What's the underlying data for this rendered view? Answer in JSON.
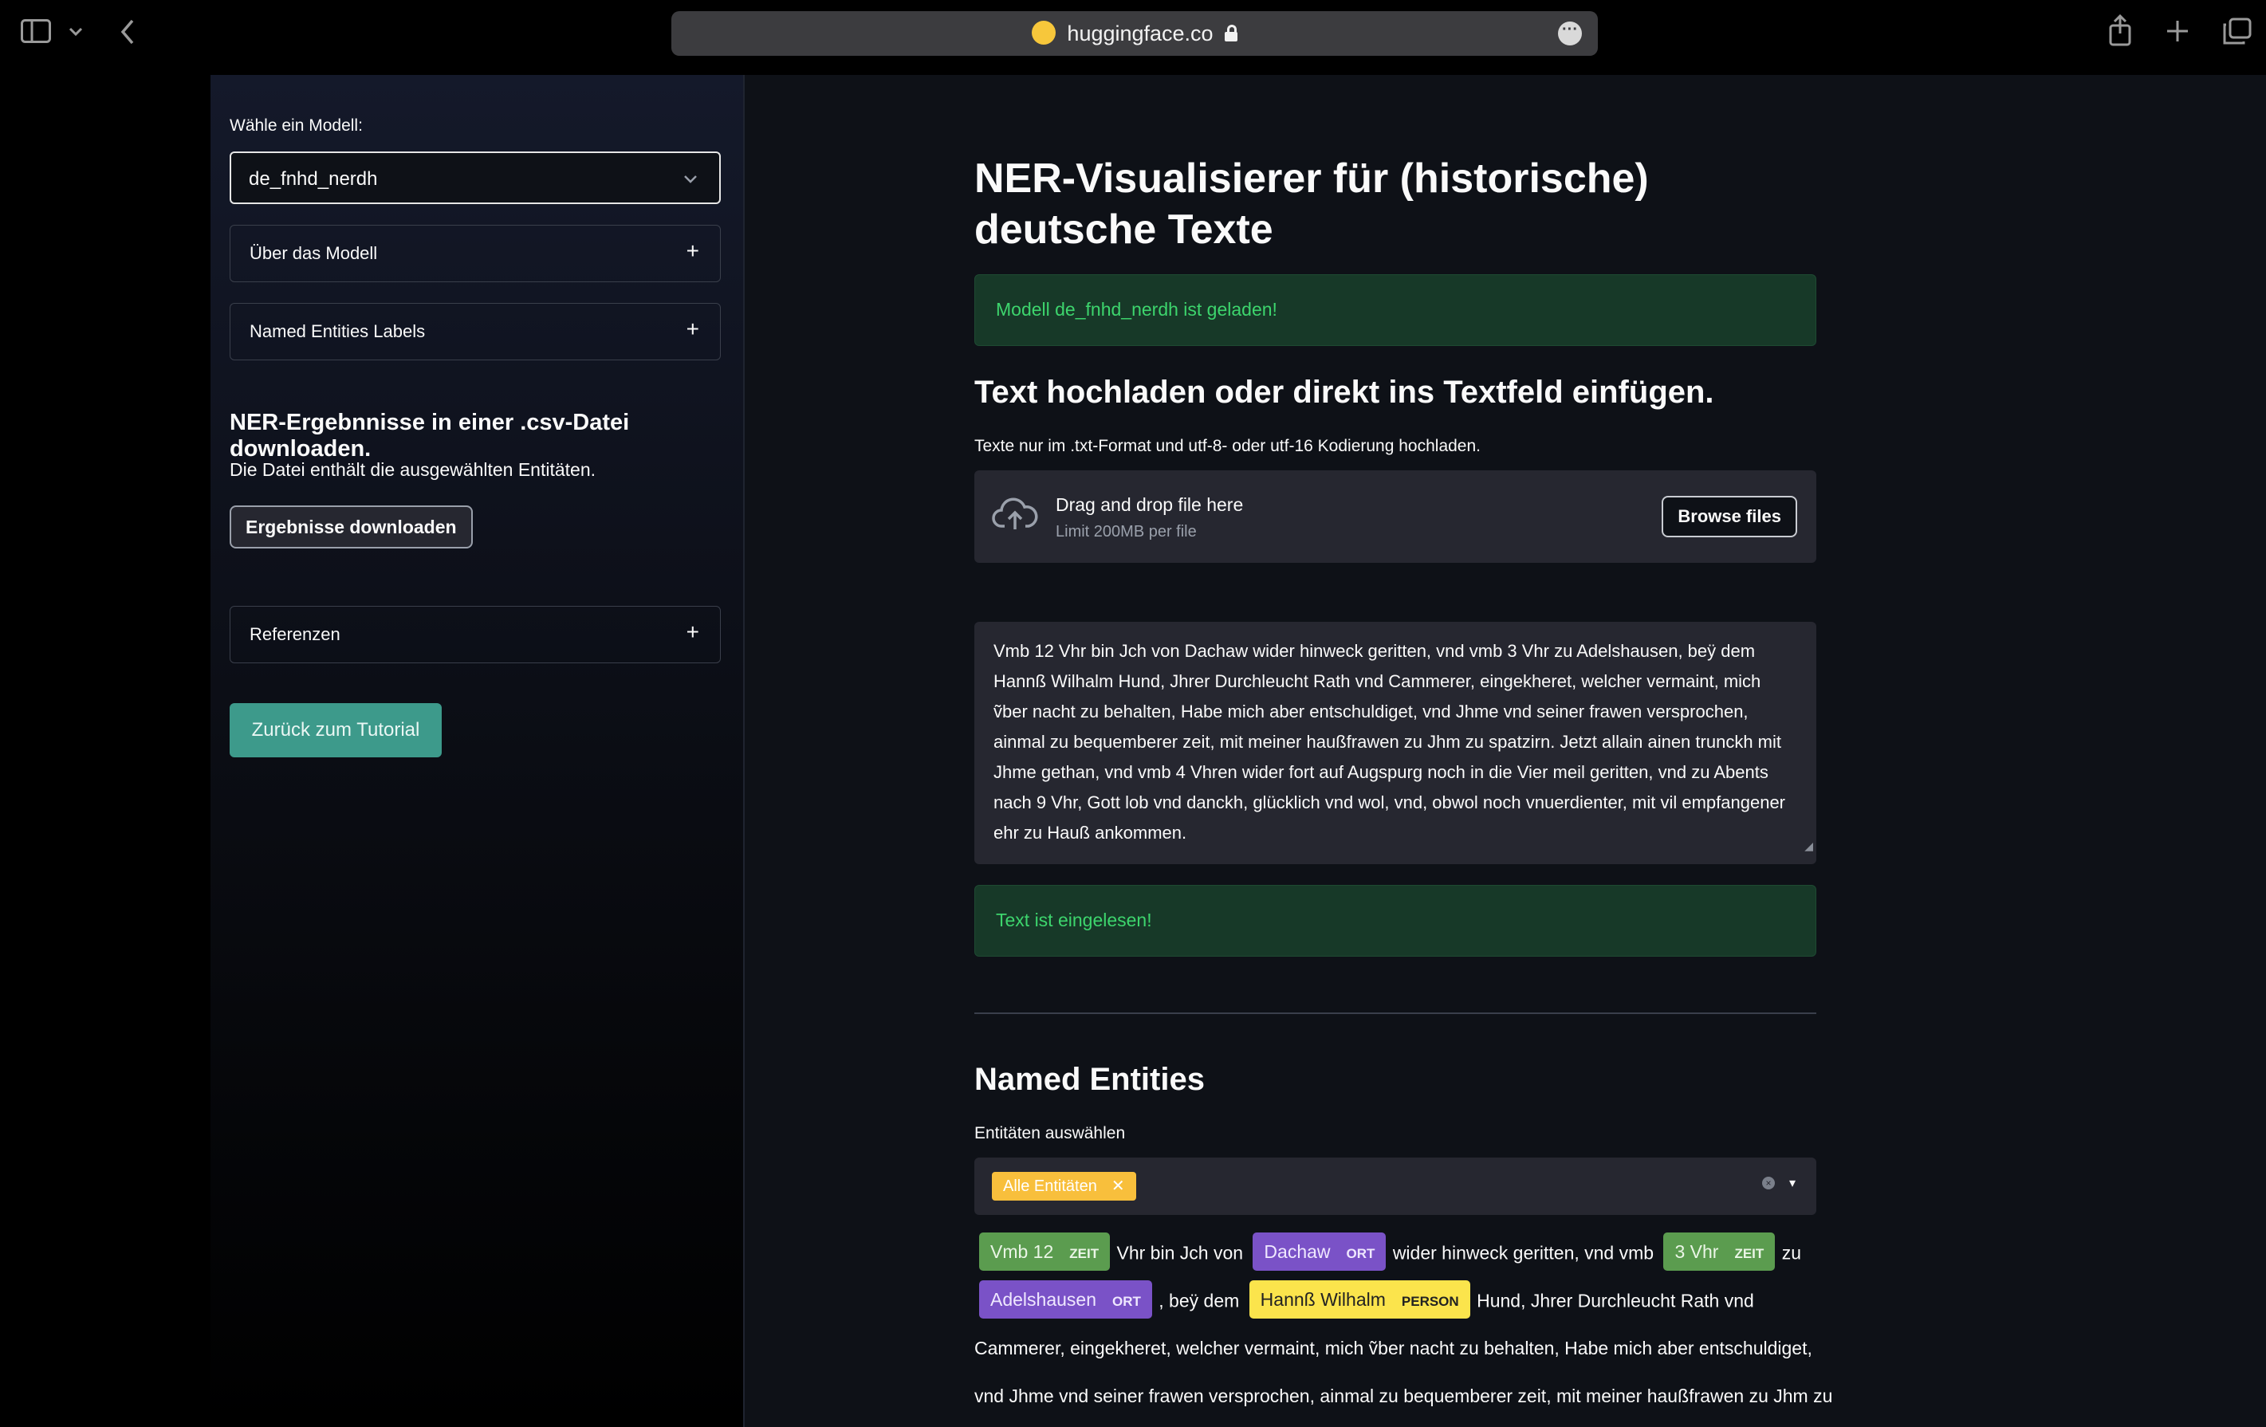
{
  "browser": {
    "url": "huggingface.co"
  },
  "sidebar": {
    "model_label": "Wähle ein Modell:",
    "model_value": "de_fnhd_nerdh",
    "expanders": [
      "Über das Modell",
      "Named Entities Labels",
      "Referenzen"
    ],
    "download_heading": "NER-Ergebnnisse in einer .csv-Datei downloaden.",
    "download_text": "Die Datei enthält die ausgewählten Entitäten.",
    "download_button": "Ergebnisse downloaden",
    "back_button": "Zurück zum Tutorial"
  },
  "main": {
    "title": "NER-Visualisierer für (historische) deutsche Texte",
    "model_loaded": "Modell de_fnhd_nerdh ist geladen!",
    "upload_heading": "Text hochladen oder direkt ins Textfeld einfügen.",
    "upload_hint": "Texte nur im .txt-Format und utf-8- oder utf-16 Kodierung hochladen.",
    "uploader_main": "Drag and drop file here",
    "uploader_sub": "Limit 200MB per file",
    "browse_button": "Browse files",
    "text_value": "Vmb 12 Vhr bin Jch von Dachaw wider hinweck geritten, vnd vmb 3 Vhr zu Adelshausen, beÿ dem Hannß Wilhalm Hund, Jhrer Durchleucht Rath vnd Cammerer, eingekheret, welcher vermaint, mich ṽber nacht zu behalten, Habe mich aber entschuldiget, vnd Jhme vnd seiner frawen versprochen, ainmal zu bequemberer zeit, mit meiner haußfrawen zu Jhm zu spatzirn. Jetzt allain ainen trunckh mit Jhme gethan, vnd vmb 4 Vhren wider fort auf Augspurg noch in die Vier meil geritten, vnd zu Abents nach 9 Vhr, Gott lob vnd danckh, glücklich vnd wol, vnd, obwol noch vnuerdienter, mit vil empfangener ehr zu Hauß ankommen.",
    "text_loaded": "Text ist eingelesen!",
    "entities_heading": "Named Entities",
    "entities_select_label": "Entitäten auswählen",
    "entities_tag": "Alle Entitäten"
  },
  "entities_view": {
    "line1": [
      {
        "text": "Vmb 12",
        "label": "ZEIT"
      },
      {
        "plain": "Vhr bin Jch von"
      },
      {
        "text": "Dachaw",
        "label": "ORT"
      },
      {
        "plain": "wider hinweck geritten, vnd vmb"
      },
      {
        "text": "3 Vhr",
        "label": "ZEIT"
      },
      {
        "plain": "zu"
      }
    ],
    "line2": [
      {
        "text": "Adelshausen",
        "label": "ORT"
      },
      {
        "plain": ", beÿ dem"
      },
      {
        "text": "Hannß Wilhalm",
        "label": "PERSON"
      },
      {
        "plain": "Hund, Jhrer Durchleucht Rath vnd"
      }
    ],
    "line3": "Cammerer, eingekheret, welcher vermaint, mich ṽber nacht zu behalten, Habe mich aber entschuldiget,",
    "line4": "vnd Jhme vnd seiner frawen versprochen, ainmal zu bequemberer zeit, mit meiner haußfrawen zu Jhm zu"
  },
  "colors": {
    "background": "#0e1117",
    "success_bg": "#173928",
    "success_text": "#3dd56d",
    "accent_teal": "#3d9a8b",
    "tag_yellow": "#f8bf3c",
    "ent_zeit": "#5b9c4f",
    "ent_ort": "#7a52c7",
    "ent_person": "#fbe44c"
  }
}
